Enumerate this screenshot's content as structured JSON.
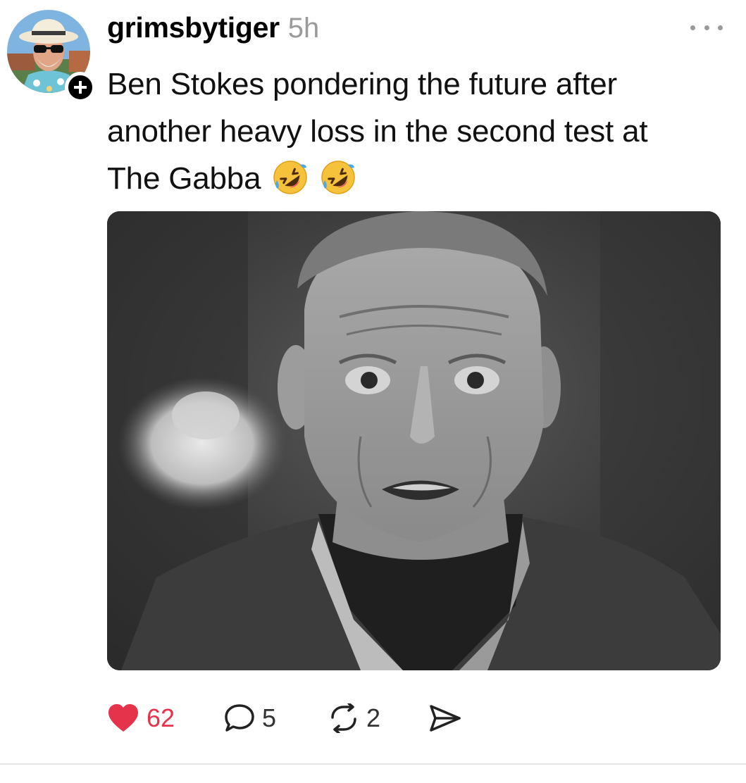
{
  "post": {
    "username": "grimsbytiger",
    "timestamp": "5h",
    "text_lines": [
      "Ben Stokes pondering the future after",
      "another heavy loss in the second test at",
      "The Gabba"
    ],
    "emojis": [
      "rolling-on-floor-laughing",
      "rolling-on-floor-laughing"
    ],
    "media": {
      "kind": "black-and-white photo of a startled older man"
    }
  },
  "actions": {
    "likes": "62",
    "replies": "5",
    "reposts": "2"
  },
  "icons": {
    "avatar": "avatar-photo",
    "follow": "plus-icon",
    "more": "more-dots-icon",
    "like": "heart-icon",
    "reply": "comment-icon",
    "repost": "repost-icon",
    "share": "send-icon"
  },
  "colors": {
    "like_active": "#e5334b",
    "timestamp": "#9a9a9a",
    "text": "#111111"
  }
}
